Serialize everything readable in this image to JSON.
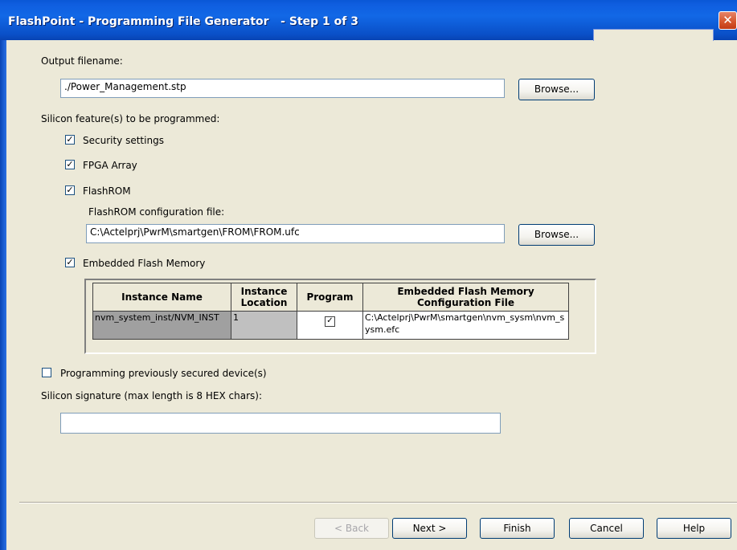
{
  "window": {
    "title": "FlashPoint - Programming File Generator   - Step 1 of 3",
    "close_glyph": "✕"
  },
  "output": {
    "label": "Output filename:",
    "value": "./Power_Management.stp",
    "browse_label": "Browse..."
  },
  "silicon": {
    "label": "Silicon feature(s) to be programmed:",
    "security_label": "Security settings",
    "security_checked": true,
    "fpga_label": "FPGA Array",
    "fpga_checked": true,
    "flashrom_label": "FlashROM",
    "flashrom_checked": true,
    "flashrom_config_label": "FlashROM configuration file:",
    "flashrom_config_value": "C:\\Actelprj\\PwrM\\smartgen\\FROM\\FROM.ufc",
    "flashrom_browse_label": "Browse...",
    "efm_label": "Embedded Flash Memory",
    "efm_checked": true
  },
  "efm_table": {
    "headers": {
      "instance_name": "Instance Name",
      "instance_location": "Instance Location",
      "program": "Program",
      "config_file": "Embedded Flash Memory Configuration File"
    },
    "rows": [
      {
        "instance_name": "nvm_system_inst/NVM_INST",
        "instance_location": "1",
        "program_checked": true,
        "config_file": "C:\\Actelprj\\PwrM\\smartgen\\nvm_sysm\\nvm_sysm.efc"
      }
    ]
  },
  "secured": {
    "label": "Programming previously secured device(s)",
    "checked": false
  },
  "signature": {
    "label": "Silicon signature (max length is 8 HEX chars):",
    "value": ""
  },
  "footer": {
    "back_label": "< Back",
    "next_label": "Next >",
    "finish_label": "Finish",
    "cancel_label": "Cancel",
    "help_label": "Help"
  },
  "checkmark_glyph": "✓",
  "colors": {
    "titlebar": "#0a57d6",
    "dialog_bg": "#ece9d8",
    "close_button": "#d5542b"
  }
}
